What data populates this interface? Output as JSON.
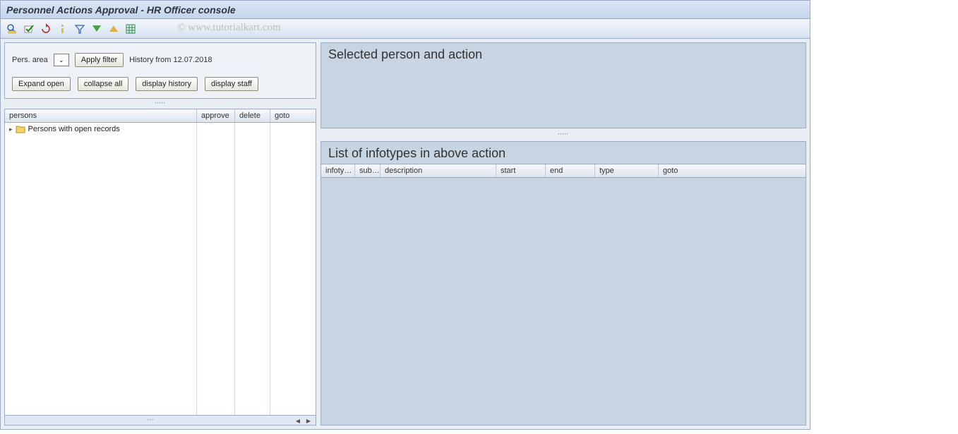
{
  "title": "Personnel Actions Approval - HR Officer console",
  "watermark": "©  www.tutorialkart.com",
  "toolbar_icons": [
    "find-icon",
    "check-icon",
    "refresh-icon",
    "info-icon",
    "filter-icon",
    "expand-icon",
    "collapse-icon",
    "layout-icon"
  ],
  "filter": {
    "pers_area_label": "Pers. area",
    "apply_filter": "Apply filter",
    "history_from": "History from 12.07.2018"
  },
  "buttons": {
    "expand_open": "Expand open",
    "collapse_all": "collapse all",
    "display_history": "display history",
    "display_staff": "display staff"
  },
  "tree": {
    "columns": {
      "persons": "persons",
      "approve": "approve",
      "delete": "delete",
      "goto": "goto"
    },
    "root_item": "Persons with open records"
  },
  "right": {
    "selected_title": "Selected person and action",
    "list_title": "List of infotypes in above action",
    "columns": {
      "infotype": "infoty…",
      "sub": "sub…",
      "description": "description",
      "start": "start",
      "end": "end",
      "type": "type",
      "goto": "goto"
    }
  }
}
